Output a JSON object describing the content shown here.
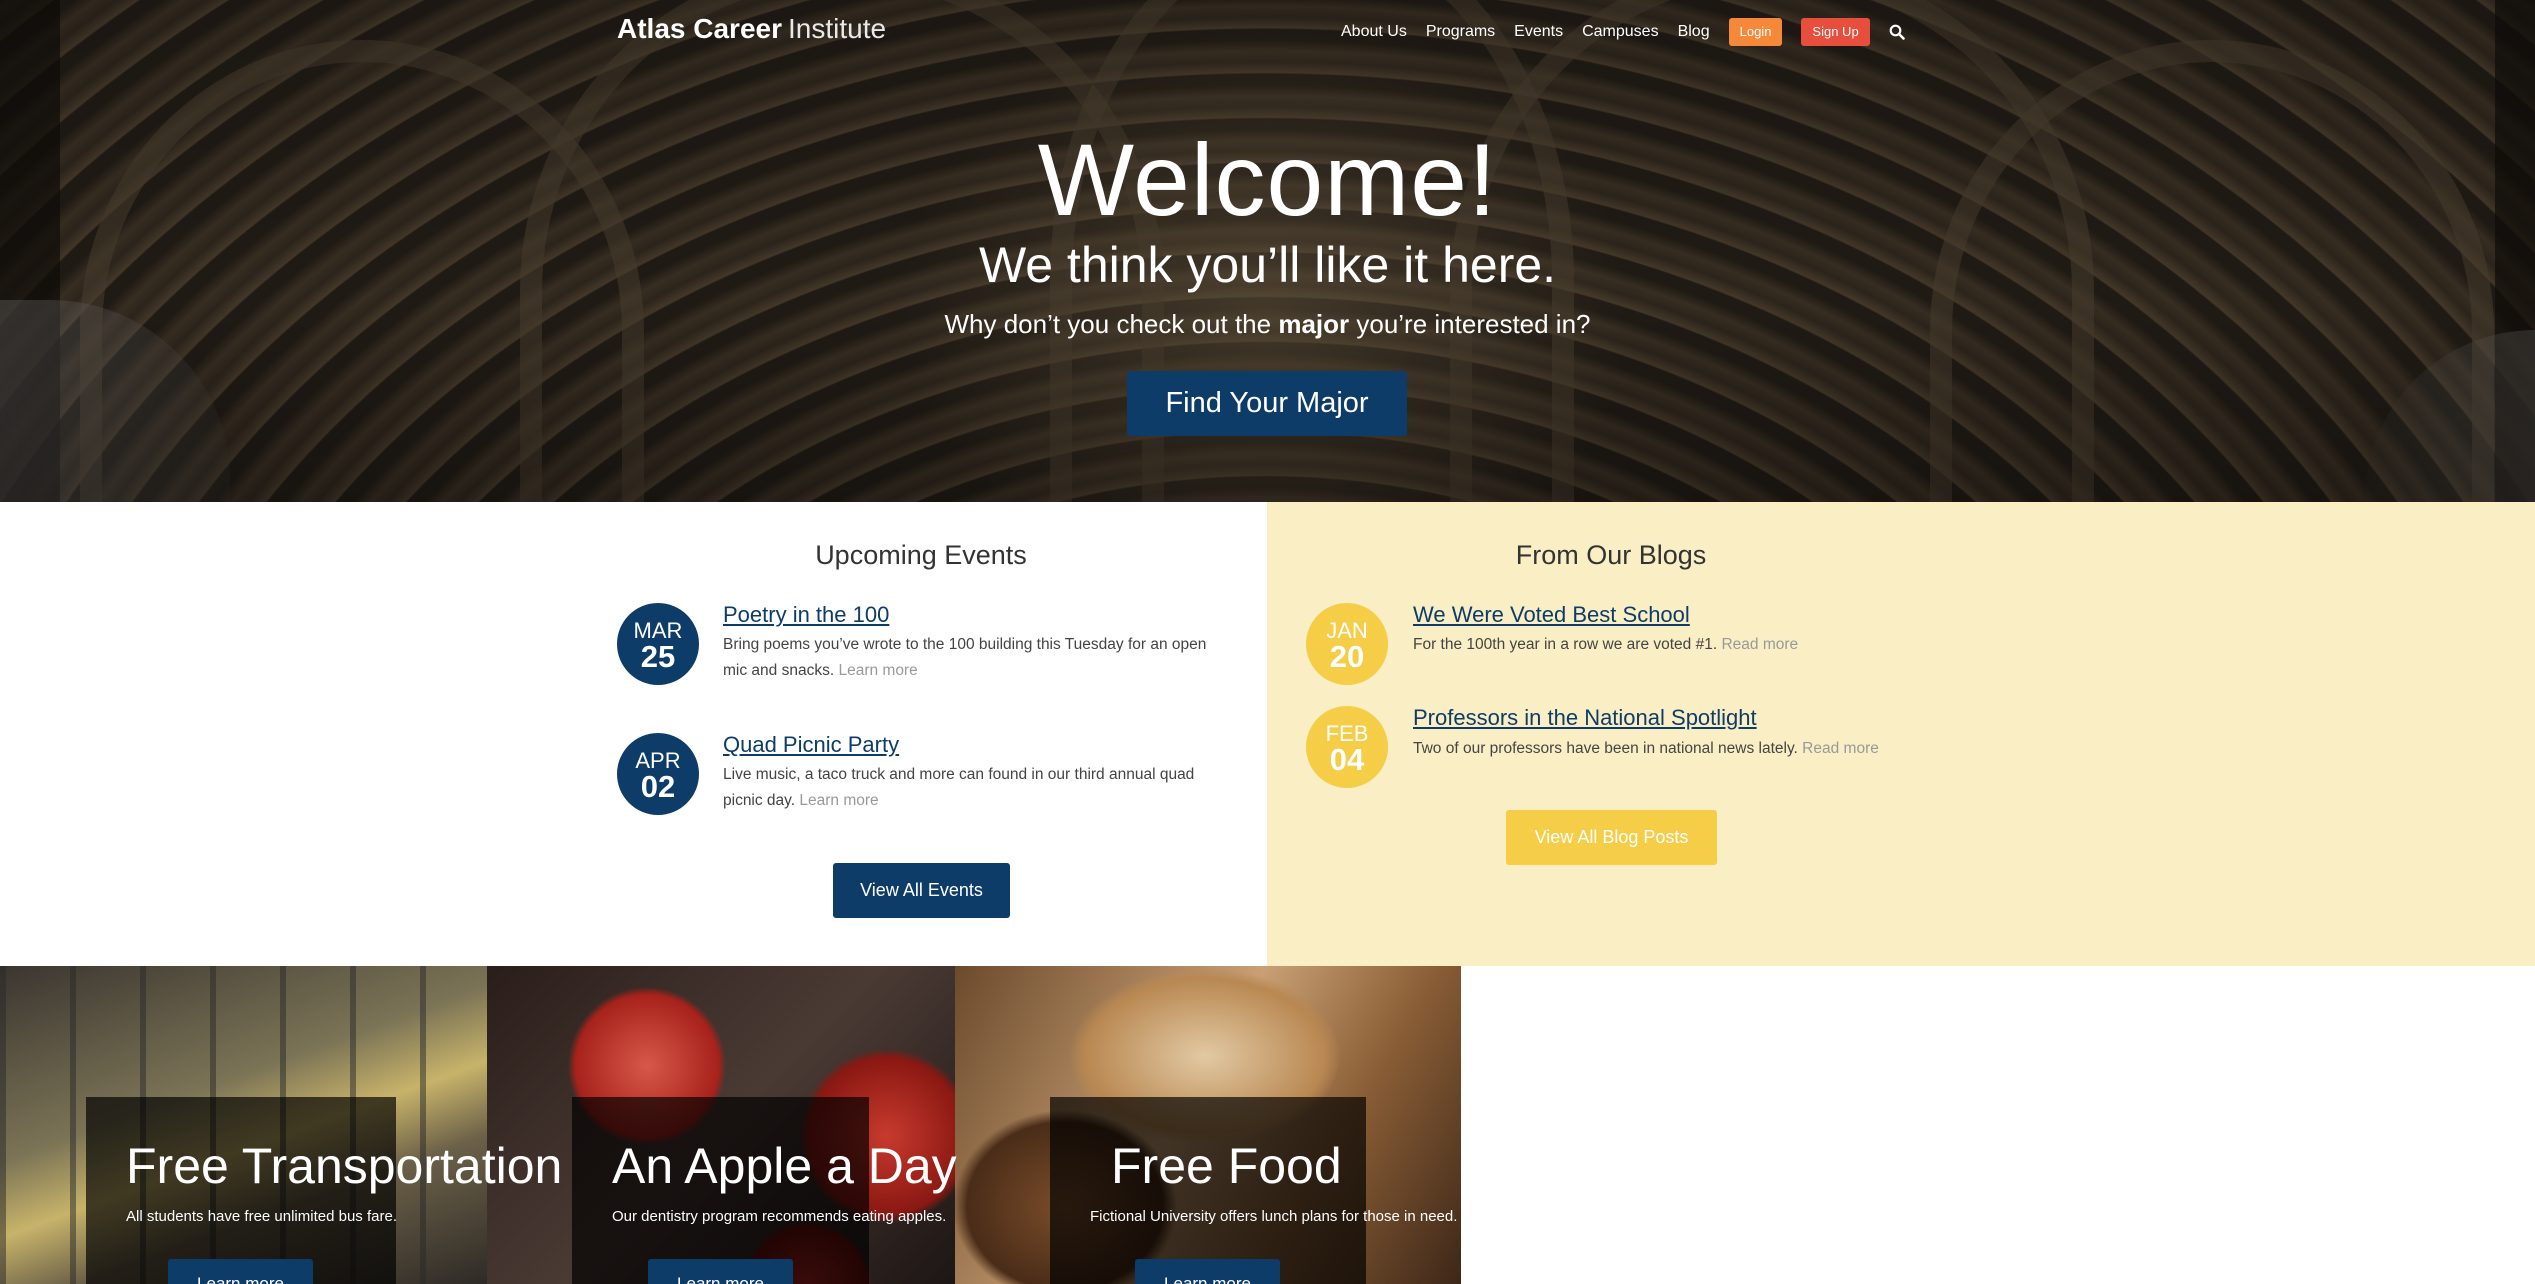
{
  "header": {
    "brand_bold": "Atlas Career",
    "brand_light": "Institute",
    "nav": [
      "About Us",
      "Programs",
      "Events",
      "Campuses",
      "Blog"
    ],
    "login_label": "Login",
    "signup_label": "Sign Up",
    "search_icon": "search-icon"
  },
  "hero": {
    "title": "Welcome!",
    "subtitle": "We think you’ll like it here.",
    "prompt_before": "Why don’t you check out the ",
    "prompt_bold": "major",
    "prompt_after": " you’re interested in?",
    "cta_label": "Find Your Major"
  },
  "events": {
    "heading": "Upcoming Events",
    "items": [
      {
        "month": "MAR",
        "day": "25",
        "title": "Poetry in the 100",
        "text": "Bring poems you’ve wrote to the 100 building this Tuesday for an open mic and snacks.",
        "link": "Learn more"
      },
      {
        "month": "APR",
        "day": "02",
        "title": "Quad Picnic Party",
        "text": "Live music, a taco truck and more can found in our third annual quad picnic day.",
        "link": "Learn more"
      }
    ],
    "button_label": "View All Events"
  },
  "blogs": {
    "heading": "From Our Blogs",
    "items": [
      {
        "month": "JAN",
        "day": "20",
        "title": "We Were Voted Best School",
        "text": "For the 100th year in a row we are voted #1.",
        "link": "Read more"
      },
      {
        "month": "FEB",
        "day": "04",
        "title": "Professors in the National Spotlight",
        "text": "Two of our professors have been in national news lately.",
        "link": "Read more"
      }
    ],
    "button_label": "View All Blog Posts"
  },
  "slides": [
    {
      "title": "Free Transportation",
      "text": "All students have free unlimited bus fare.",
      "button": "Learn more"
    },
    {
      "title": "An Apple a Day",
      "text": "Our dentistry program recommends eating apples.",
      "button": "Learn more"
    },
    {
      "title": "Free Food",
      "text": "Fictional University offers lunch plans for those in need.",
      "button": "Learn more"
    }
  ],
  "colors": {
    "navy": "#0e3c69",
    "login": "#f6883a",
    "signup": "#e74e3b",
    "blog_bg": "#faeec4",
    "blog_accent": "#f5cd47"
  }
}
